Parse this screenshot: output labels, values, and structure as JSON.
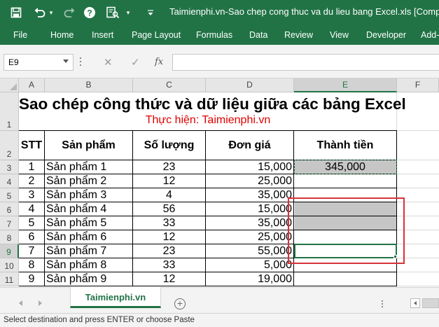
{
  "window": {
    "title": "Taimienphi.vn-Sao chep cong thuc va du lieu bang Excel.xls  [Compatibil",
    "brand_color": "#217346"
  },
  "quick_access": [
    "save-icon",
    "undo-icon",
    "redo-icon",
    "help-icon",
    "print-preview-icon",
    "customize-qat-icon"
  ],
  "ribbon": {
    "tabs": [
      "File",
      "Home",
      "Insert",
      "Page Layout",
      "Formulas",
      "Data",
      "Review",
      "View",
      "Developer",
      "Add-"
    ]
  },
  "formula_bar": {
    "name_box": "E9",
    "cancel_symbol": "✕",
    "enter_symbol": "✓",
    "fx_label": "fx",
    "formula": ""
  },
  "columns": [
    "A",
    "B",
    "C",
    "D",
    "E",
    "F"
  ],
  "rows": [
    "1",
    "2",
    "3",
    "4",
    "5",
    "6",
    "7",
    "8",
    "9",
    "10",
    "11"
  ],
  "sheet": {
    "title": "Sao chép công thức và dữ liệu giữa các bảng Excel",
    "subtitle": "Thực hiện: Taimienphi.vn",
    "headers": [
      "STT",
      "Sản phẩm",
      "Số lượng",
      "Đơn giá",
      "Thành tiền"
    ],
    "data": [
      {
        "stt": "1",
        "product": "Sản phẩm 1",
        "qty": "23",
        "price": "15,000",
        "total": "345,000"
      },
      {
        "stt": "2",
        "product": "Sản phẩm 2",
        "qty": "12",
        "price": "25,000",
        "total": ""
      },
      {
        "stt": "3",
        "product": "Sản phẩm 3",
        "qty": "4",
        "price": "35,000",
        "total": ""
      },
      {
        "stt": "4",
        "product": "Sản phẩm 4",
        "qty": "56",
        "price": "15,000",
        "total": ""
      },
      {
        "stt": "5",
        "product": "Sản phẩm 5",
        "qty": "33",
        "price": "35,000",
        "total": ""
      },
      {
        "stt": "6",
        "product": "Sản phẩm 6",
        "qty": "12",
        "price": "25,000",
        "total": ""
      },
      {
        "stt": "7",
        "product": "Sản phẩm 7",
        "qty": "23",
        "price": "55,000",
        "total": ""
      },
      {
        "stt": "8",
        "product": "Sản phẩm 8",
        "qty": "33",
        "price": "5,000",
        "total": ""
      },
      {
        "stt": "9",
        "product": "Sản phẩm 9",
        "qty": "12",
        "price": "19,000",
        "total": ""
      }
    ]
  },
  "sheet_tabs": {
    "active": "Taimienphi.vn",
    "add_symbol": "+"
  },
  "status_bar": {
    "message": "Select destination and press ENTER or choose Paste"
  },
  "colors": {
    "subtitle": "#e00000",
    "highlight_box": "#d6333a",
    "selection_fill": "#c6c6c6"
  }
}
